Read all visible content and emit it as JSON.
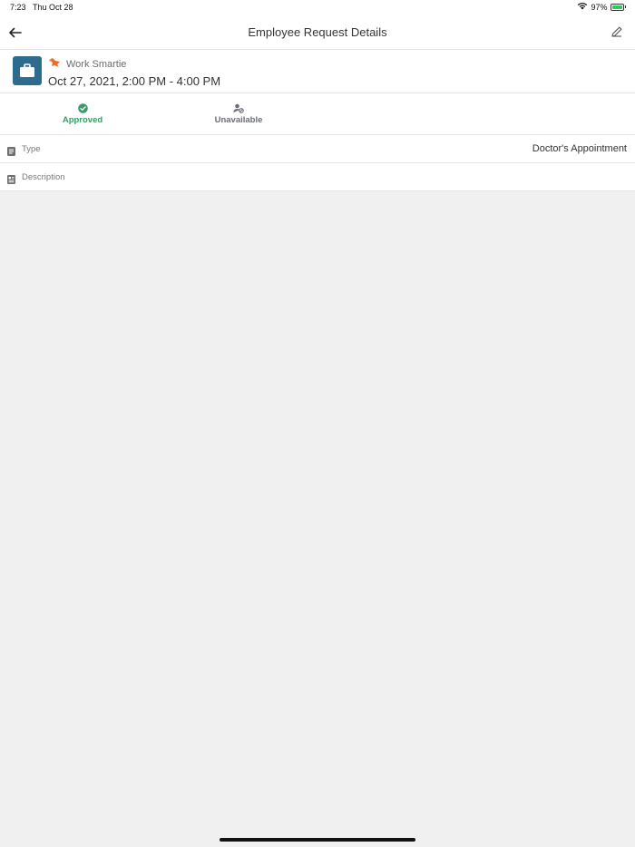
{
  "status_bar": {
    "time": "7:23",
    "date": "Thu Oct 28",
    "battery_percent": "97%",
    "icons": [
      "wifi-icon",
      "battery-charging-icon"
    ]
  },
  "nav": {
    "title": "Employee Request Details",
    "back_icon": "arrow-left-icon",
    "edit_icon": "pencil-icon"
  },
  "header": {
    "org_name": "Work Smartie",
    "org_logo_icon": "fox-logo-icon",
    "request_time": "Oct 27, 2021, 2:00 PM - 4:00 PM",
    "request_icon": "briefcase-icon",
    "tile_color": "#2e6c8f"
  },
  "statuses": [
    {
      "label": "Approved",
      "icon": "check-circle-icon",
      "color": "#3d9a6a"
    },
    {
      "label": "Unavailable",
      "icon": "user-unavailable-icon",
      "color": "#6b6e78"
    }
  ],
  "details": {
    "type": {
      "label": "Type",
      "value": "Doctor's Appointment",
      "icon": "document-icon"
    },
    "description": {
      "label": "Description",
      "value": "",
      "icon": "notes-icon"
    }
  }
}
